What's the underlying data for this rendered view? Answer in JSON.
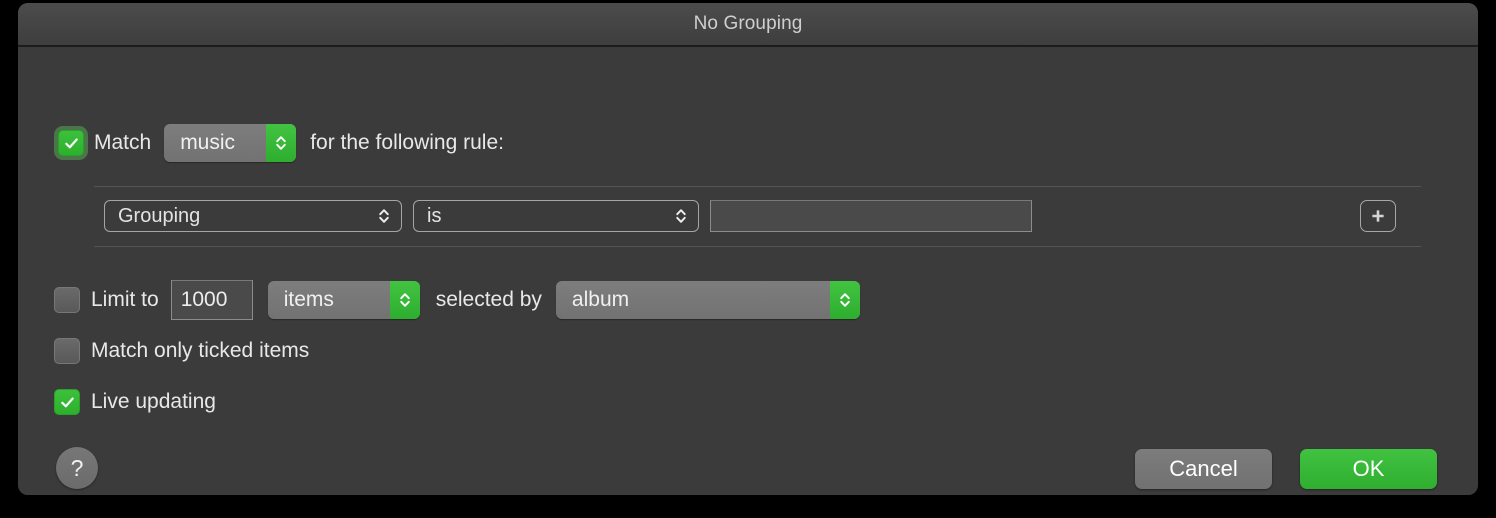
{
  "window": {
    "title": "No Grouping"
  },
  "match_row": {
    "checkbox_checked": true,
    "checkbox_icon": "checkmark-icon",
    "prefix_label": "Match",
    "scope_value": "music",
    "suffix_label": "for the following rule:"
  },
  "rules": [
    {
      "field_value": "Grouping",
      "operator_value": "is",
      "value_text": "",
      "value_placeholder": "",
      "add_icon": "plus-icon"
    }
  ],
  "limit_row": {
    "checkbox_checked": false,
    "label": "Limit to",
    "amount_value": "1000",
    "unit_value": "items",
    "selected_by_label": "selected by",
    "selected_by_value": "album"
  },
  "ticked_row": {
    "checkbox_checked": false,
    "label": "Match only ticked items"
  },
  "live_row": {
    "checkbox_checked": true,
    "checkbox_icon": "checkmark-icon",
    "label": "Live updating"
  },
  "footer": {
    "help_label": "?",
    "help_icon": "question-mark-icon",
    "cancel_label": "Cancel",
    "ok_label": "OK"
  },
  "colors": {
    "window_bg": "#3c3b3b",
    "titlebar_top": "#4d4c4c",
    "titlebar_bottom": "#3f3e3e",
    "accent_green": "#2fae2f",
    "checkbox_green": "#3dc13d",
    "text": "#e8e8e8",
    "title_text": "#cfcfcf",
    "popup_gray": "#7e7d7d",
    "field_bg": "#4b4a4a",
    "divider": "#555454"
  }
}
